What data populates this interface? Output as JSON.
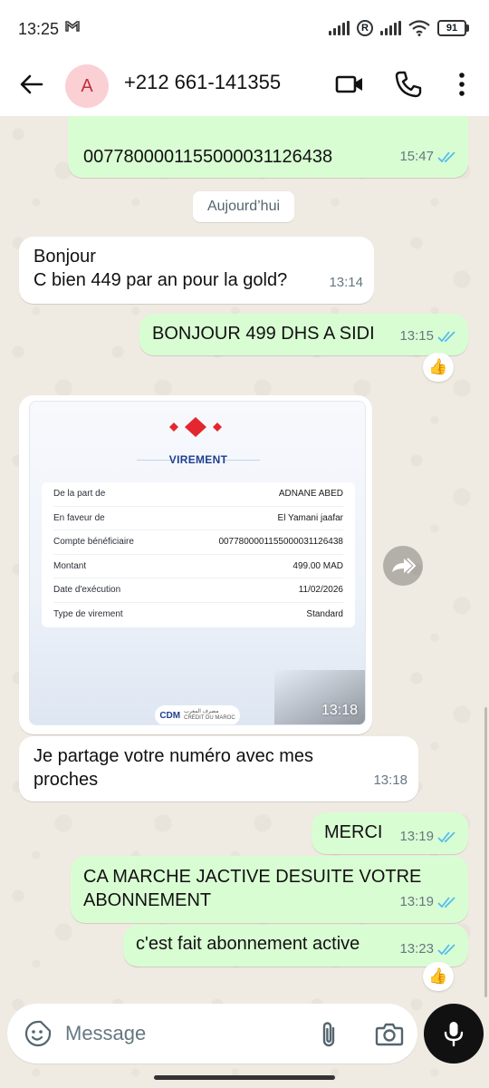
{
  "status": {
    "time": "13:25",
    "battery": "91"
  },
  "header": {
    "avatar_letter": "A",
    "contact": "+212 661-141355"
  },
  "date_chip": "Aujourd’hui",
  "messages": [
    {
      "text": "0077800001155000031126438",
      "time": "15:47"
    },
    {
      "text_line1": "Bonjour",
      "text_line2": "C bien 449 par an pour la gold?",
      "time": "13:14"
    },
    {
      "text": "BONJOUR 499 DHS A SIDI",
      "time": "13:15",
      "reaction": "👍"
    },
    {
      "time": "13:18"
    },
    {
      "text_line1": "Je partage votre numéro avec mes",
      "text_line2": "proches",
      "time": "13:18"
    },
    {
      "text": "MERCI",
      "time": "13:19"
    },
    {
      "text_line1": "CA MARCHE JACTIVE DESUITE VOTRE",
      "text_line2": "ABONNEMENT",
      "time": "13:19"
    },
    {
      "text": "c'est fait abonnement active",
      "time": "13:23",
      "reaction": "👍"
    }
  ],
  "receipt": {
    "title": "VIREMENT",
    "rows": [
      {
        "label": "De la part de",
        "value": "ADNANE ABED"
      },
      {
        "label": "En faveur de",
        "value": "El Yamani jaafar"
      },
      {
        "label": "Compte bénéficiaire",
        "value": "0077800001155000031126438"
      },
      {
        "label": "Montant",
        "value": "499.00 MAD"
      },
      {
        "label": "Date d'exécution",
        "value": "11/02/2026"
      },
      {
        "label": "Type de virement",
        "value": "Standard"
      }
    ],
    "bank_logo": "CDM",
    "bank_arabic": "مصرف المغرب",
    "bank_name": "CRÉDIT DU MAROC"
  },
  "input": {
    "placeholder": "Message"
  },
  "colors": {
    "outgoing": "#d9fdd3",
    "incoming": "#ffffff",
    "tick_blue": "#53bdeb",
    "wallpaper": "#efeae2"
  }
}
